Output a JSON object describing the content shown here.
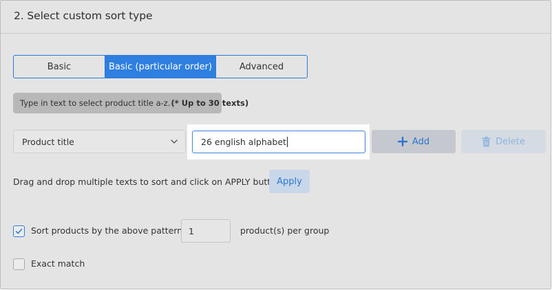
{
  "section": {
    "title": "2. Select custom sort type"
  },
  "sort_types": {
    "options": [
      "Basic",
      "Basic (particular order)",
      "Advanced"
    ],
    "selected": "Basic (particular order)"
  },
  "hint": {
    "text": "Type in text to select product title a-z.",
    "emphasis": "(* Up to 30 texts)"
  },
  "field_select": {
    "value": "Product title",
    "icon": "chevron-down-icon"
  },
  "text_input": {
    "value": "26 english alphabet"
  },
  "actions": {
    "add_label": "Add",
    "add_icon": "plus-icon",
    "delete_label": "Delete",
    "delete_icon": "trash-icon"
  },
  "drag": {
    "instruction": "Drag and drop multiple texts to sort and click on APPLY button",
    "apply_label": "Apply"
  },
  "pattern": {
    "checked": true,
    "label": "Sort products by the above pattern",
    "group_size": "1",
    "suffix": "product(s) per group"
  },
  "exact_match": {
    "checked": false,
    "label": "Exact match"
  },
  "colors": {
    "accent": "#2e7fe0",
    "panel_bg": "#e4e4e4",
    "hint_bg": "#b8b8b8",
    "link_text": "#2c74cf"
  }
}
